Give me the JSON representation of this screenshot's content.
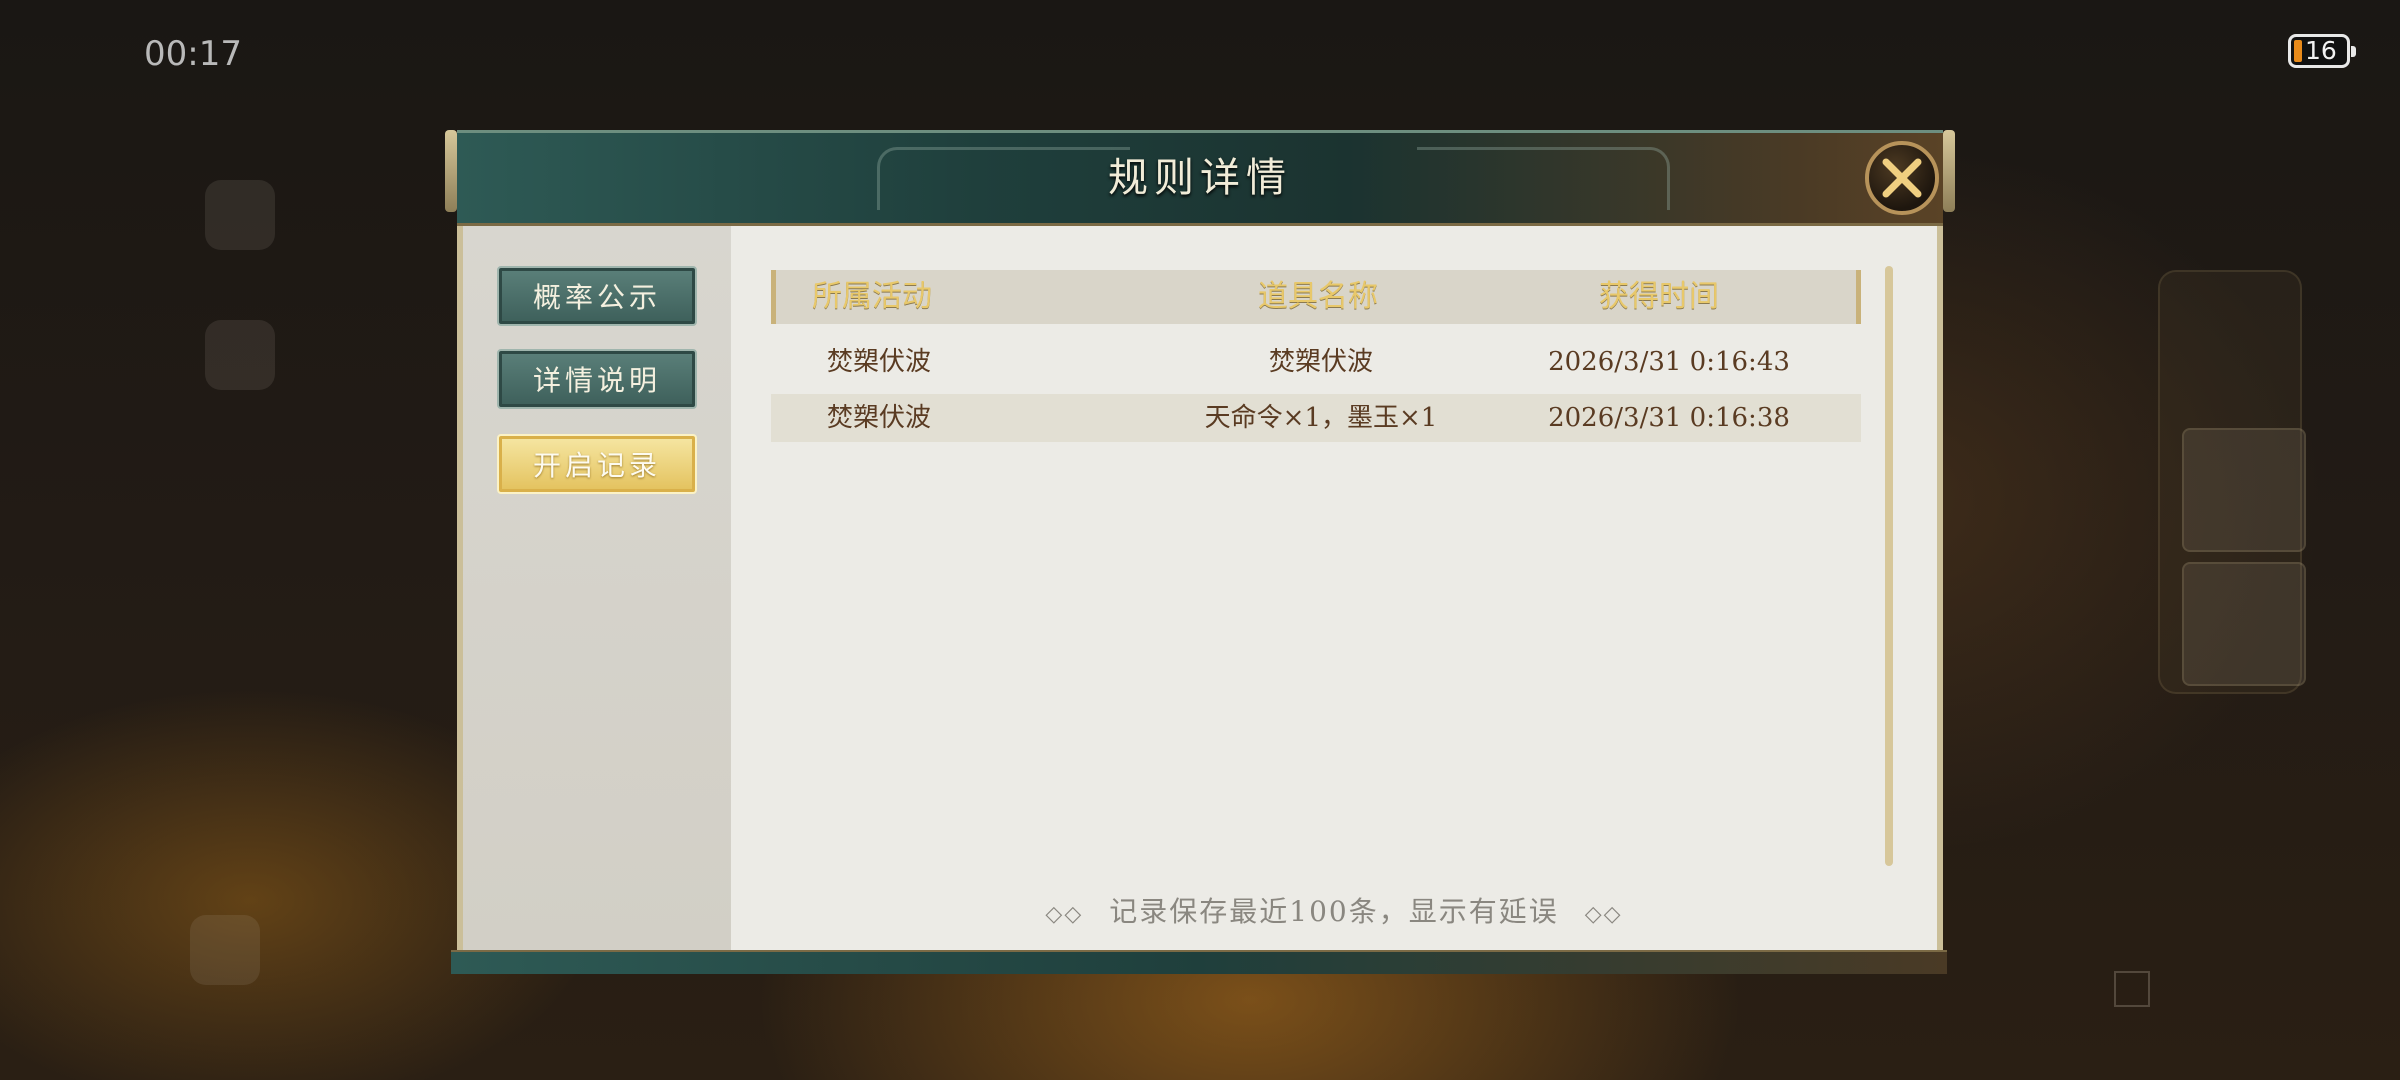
{
  "background": {
    "timer": "00:17",
    "battery_level": "16"
  },
  "dialog": {
    "title": "规则详情",
    "tabs": [
      {
        "label": "概率公示",
        "active": false
      },
      {
        "label": "详情说明",
        "active": false
      },
      {
        "label": "开启记录",
        "active": true
      }
    ],
    "table": {
      "headers": [
        "所属活动",
        "道具名称",
        "获得时间"
      ],
      "rows": [
        {
          "activity": "焚槊伏波",
          "item": "焚槊伏波",
          "time": "2026/3/31 0:16:43"
        },
        {
          "activity": "焚槊伏波",
          "item": "天命令×1，墨玉×1",
          "time": "2026/3/31 0:16:38"
        }
      ]
    },
    "footer_note": "记录保存最近100条，显示有延误",
    "footer_icon": "double-diamond-icon",
    "close_icon": "close-x-icon"
  },
  "colors": {
    "header_teal": "#1f3f3c",
    "active_tab_gold": "#e3c15c",
    "inactive_tab_teal": "#3d5f5a",
    "header_text_gold": "#e8c86a",
    "row_text_brown": "#5a3b22"
  }
}
